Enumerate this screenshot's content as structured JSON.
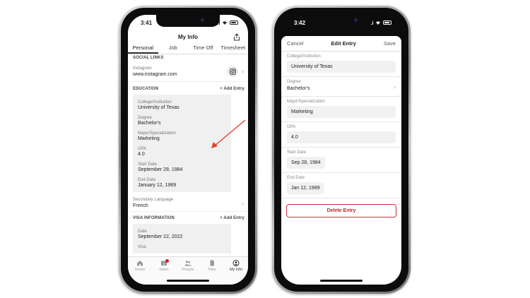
{
  "left_phone": {
    "status_time": "3:41",
    "nav_title": "My Info",
    "tabs": [
      {
        "label": "Personal"
      },
      {
        "label": "Job"
      },
      {
        "label": "Time Off"
      },
      {
        "label": "Timesheet"
      }
    ],
    "social_section": {
      "title": "SOCIAL LINKS"
    },
    "instagram": {
      "label": "Instagram",
      "value": "www.instagram.com"
    },
    "education_section": {
      "title": "EDUCATION",
      "add_label": "+ Add Entry"
    },
    "education_fields": [
      {
        "label": "College/Institution",
        "value": "University of Texas"
      },
      {
        "label": "Degree",
        "value": "Bachelor's"
      },
      {
        "label": "Major/Specialization",
        "value": "Marketing"
      },
      {
        "label": "GPA",
        "value": "4.0"
      },
      {
        "label": "Start Date",
        "value": "September 28, 1984"
      },
      {
        "label": "End Date",
        "value": "January 12, 1989"
      }
    ],
    "secondary_language": {
      "label": "Secondary Language",
      "value": "French"
    },
    "visa_section": {
      "title": "VISA INFORMATION",
      "add_label": "+ Add Entry"
    },
    "visa_fields": [
      {
        "label": "Date",
        "value": "September 22, 2022"
      },
      {
        "label": "Visa",
        "value": ""
      }
    ],
    "tabbar": [
      {
        "label": "Home",
        "icon": "home-icon"
      },
      {
        "label": "Inbox",
        "icon": "inbox-icon"
      },
      {
        "label": "People",
        "icon": "people-icon"
      },
      {
        "label": "Files",
        "icon": "files-icon"
      },
      {
        "label": "My Info",
        "icon": "user-icon"
      }
    ],
    "active_tab": "My Info"
  },
  "right_phone": {
    "status_time": "3:42",
    "sheet": {
      "cancel_label": "Cancel",
      "title": "Edit Entry",
      "save_label": "Save"
    },
    "fields": [
      {
        "label": "College/Institution",
        "value": "University of Texas"
      },
      {
        "label": "Degree",
        "value": "Bachelor's"
      },
      {
        "label": "Major/Specialization",
        "value": "Marketing"
      },
      {
        "label": "GPA",
        "value": "4.0"
      },
      {
        "label": "Start Date",
        "value": "Sep 28, 1984"
      },
      {
        "label": "End Date",
        "value": "Jan 12, 1989"
      }
    ],
    "delete_label": "Delete Entry"
  },
  "colors": {
    "accent_red": "#c4232d",
    "annotation_arrow": "#e0412b"
  }
}
